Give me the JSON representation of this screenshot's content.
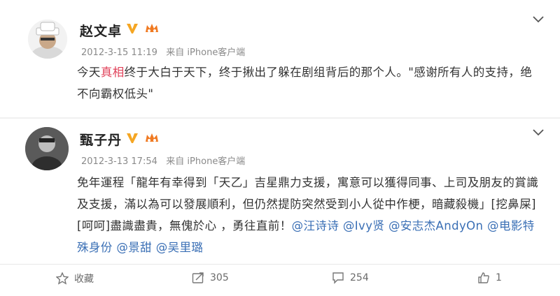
{
  "posts": [
    {
      "author": "赵文卓",
      "timestamp": "2012-3-15 11:19",
      "source": "来自 iPhone客户端",
      "text_before": "今天",
      "text_highlight": "真相",
      "text_after": "终于大白于天下，终于揪出了躲在剧组背后的那个人。\"感谢所有人的支持，绝不向霸权低头\"",
      "avatar_icon": "avatar-man-white-hat-icon",
      "verified_icon": "verified-v-icon",
      "vip_icon": "vip-crown-icon"
    },
    {
      "author": "甄子丹",
      "timestamp": "2012-3-13 17:54",
      "source": "来自 iPhone客户端",
      "text_main": "免年運程「龍年有幸得到「天乙」吉星鼎力支援，寓意可以獲得同事、上司及朋友的賞識及支援，滿以為可以發展順利，但仍然提防突然受到小人從中作梗，暗藏殺機」[挖鼻屎][呵呵]盡識盡貴，無傀於心 ，勇往直前！",
      "mentions": [
        "@汪诗诗",
        "@Ivy贤",
        "@安志杰AndyOn",
        "@电影特殊身份",
        "@景甜",
        "@吴里璐"
      ],
      "avatar_icon": "avatar-man-dark-icon",
      "verified_icon": "verified-v-icon",
      "vip_icon": "vip-crown-icon"
    }
  ],
  "toolbar": {
    "favorite_label": "收藏",
    "repost_count": "305",
    "comment_count": "254",
    "like_count": "1"
  },
  "colors": {
    "highlight": "#e0425a",
    "link": "#3a6fb5",
    "verified": "#f5a623"
  }
}
